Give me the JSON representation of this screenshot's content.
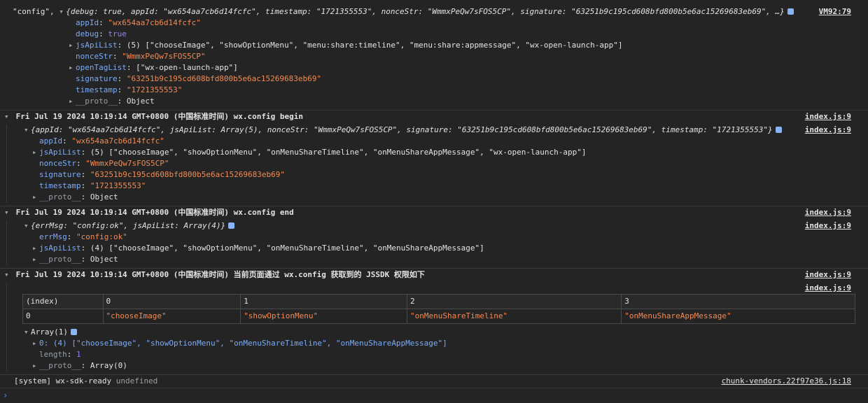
{
  "block1": {
    "string_label": "\"config\",",
    "summary_obj": "{debug: true, appId: \"wx654aa7cb6d14fcfc\", timestamp: \"1721355553\", nonceStr: \"WmmxPeQw7sFOS5CP\", signature: \"63251b9c195cd608bfd800b5e6ac15269683eb69\", …}",
    "source": "VM92:79",
    "props": [
      {
        "key": "appId",
        "val": "\"wx654aa7cb6d14fcfc\"",
        "kind": "str"
      },
      {
        "key": "debug",
        "val": "true",
        "kind": "bool"
      },
      {
        "key": "jsApiList",
        "val": "(5) [\"chooseImage\", \"showOptionMenu\", \"menu:share:timeline\", \"menu:share:appmessage\", \"wx-open-launch-app\"]",
        "kind": "arr"
      },
      {
        "key": "nonceStr",
        "val": "\"WmmxPeQw7sFOS5CP\"",
        "kind": "str"
      },
      {
        "key": "openTagList",
        "val": "[\"wx-open-launch-app\"]",
        "kind": "arr"
      },
      {
        "key": "signature",
        "val": "\"63251b9c195cd608bfd800b5e6ac15269683eb69\"",
        "kind": "str"
      },
      {
        "key": "timestamp",
        "val": "\"1721355553\"",
        "kind": "str"
      },
      {
        "key": "__proto__",
        "val": "Object",
        "kind": "proto"
      }
    ]
  },
  "group2": {
    "header": "Fri Jul 19 2024 10:19:14 GMT+0800 (中国标准时间) wx.config begin",
    "source": "index.js:9",
    "summary_obj": "{appId: \"wx654aa7cb6d14fcfc\", jsApiList: Array(5), nonceStr: \"WmmxPeQw7sFOS5CP\", signature: \"63251b9c195cd608bfd800b5e6ac15269683eb69\", timestamp: \"1721355553\"}",
    "summary_source": "index.js:9",
    "props": [
      {
        "key": "appId",
        "val": "\"wx654aa7cb6d14fcfc\"",
        "kind": "str"
      },
      {
        "key": "jsApiList",
        "val": "(5) [\"chooseImage\", \"showOptionMenu\", \"onMenuShareTimeline\", \"onMenuShareAppMessage\", \"wx-open-launch-app\"]",
        "kind": "arr"
      },
      {
        "key": "nonceStr",
        "val": "\"WmmxPeQw7sFOS5CP\"",
        "kind": "str"
      },
      {
        "key": "signature",
        "val": "\"63251b9c195cd608bfd800b5e6ac15269683eb69\"",
        "kind": "str"
      },
      {
        "key": "timestamp",
        "val": "\"1721355553\"",
        "kind": "str"
      },
      {
        "key": "__proto__",
        "val": "Object",
        "kind": "proto"
      }
    ]
  },
  "group3": {
    "header": "Fri Jul 19 2024 10:19:14 GMT+0800 (中国标准时间) wx.config end",
    "source": "index.js:9",
    "summary_obj": "{errMsg: \"config:ok\", jsApiList: Array(4)}",
    "summary_source": "index.js:9",
    "props": [
      {
        "key": "errMsg",
        "val": "\"config:ok\"",
        "kind": "str"
      },
      {
        "key": "jsApiList",
        "val": "(4) [\"chooseImage\", \"showOptionMenu\", \"onMenuShareTimeline\", \"onMenuShareAppMessage\"]",
        "kind": "arr"
      },
      {
        "key": "__proto__",
        "val": "Object",
        "kind": "proto"
      }
    ]
  },
  "group4": {
    "header": "Fri Jul 19 2024 10:19:14 GMT+0800 (中国标准时间) 当前页面通过 wx.config 获取到的 JSSDK 权限如下",
    "source": "index.js:9",
    "table_source": "index.js:9",
    "table": {
      "headers": [
        "(index)",
        "0",
        "1",
        "2",
        "3"
      ],
      "rows": [
        [
          "0",
          "\"chooseImage\"",
          "\"showOptionMenu\"",
          "\"onMenuShareTimeline\"",
          "\"onMenuShareAppMessage\""
        ]
      ]
    },
    "array_label": "Array(1)",
    "array_item": "0: (4) [\"chooseImage\", \"showOptionMenu\", \"onMenuShareTimeline\", \"onMenuShareAppMessage\"]",
    "length_key": "length",
    "length_val": "1",
    "proto_key": "__proto__",
    "proto_val": "Array(0)"
  },
  "system_line": {
    "tag": "[system] wx-sdk-ready",
    "value": "undefined",
    "source": "chunk-vendors.22f97e36.js:18"
  },
  "prompt_symbol": "›"
}
